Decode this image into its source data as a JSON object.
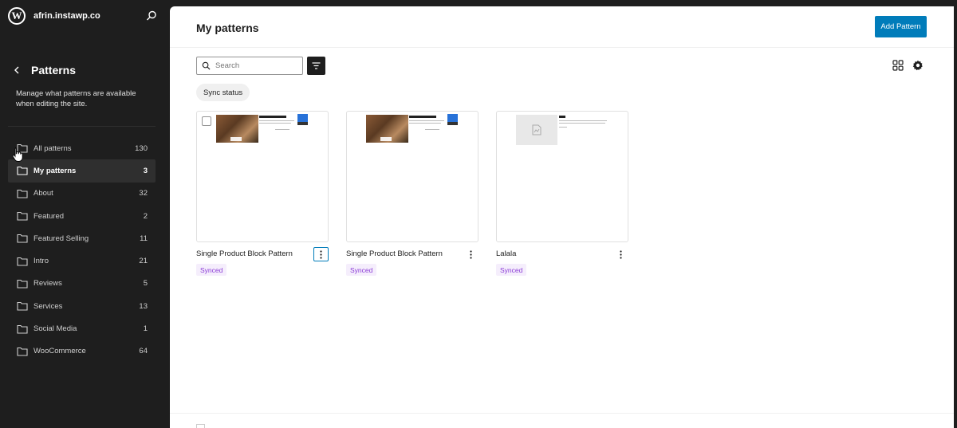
{
  "site": {
    "name": "afrin.instawp.co"
  },
  "sidebar": {
    "title": "Patterns",
    "description": "Manage what patterns are available when editing the site.",
    "items": [
      {
        "label": "All patterns",
        "count": "130"
      },
      {
        "label": "My patterns",
        "count": "3"
      },
      {
        "label": "About",
        "count": "32"
      },
      {
        "label": "Featured",
        "count": "2"
      },
      {
        "label": "Featured Selling",
        "count": "11"
      },
      {
        "label": "Intro",
        "count": "21"
      },
      {
        "label": "Reviews",
        "count": "5"
      },
      {
        "label": "Services",
        "count": "13"
      },
      {
        "label": "Social Media",
        "count": "1"
      },
      {
        "label": "WooCommerce",
        "count": "64"
      }
    ],
    "active_item": "My patterns"
  },
  "header": {
    "title": "My patterns",
    "add_button": "Add Pattern"
  },
  "toolbar": {
    "search_placeholder": "Search",
    "sync_filter": "Sync status"
  },
  "patterns": [
    {
      "title": "Single Product Block Pattern",
      "status": "Synced"
    },
    {
      "title": "Single Product Block Pattern",
      "status": "Synced"
    },
    {
      "title": "Lalala",
      "status": "Synced"
    }
  ],
  "colors": {
    "accent": "#007cba",
    "sidebar_bg": "#1e1e1e",
    "synced": "#8b3bd6"
  }
}
